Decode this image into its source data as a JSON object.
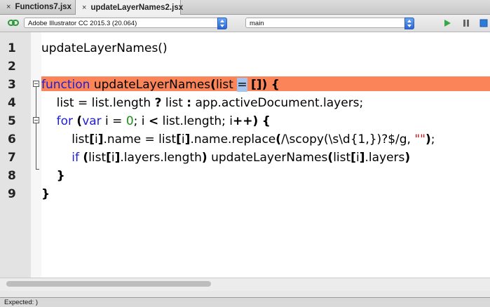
{
  "tabs": [
    {
      "label": "Functions7.jsx",
      "close": "×"
    },
    {
      "label": "updateLayerNames2.jsx",
      "close": "×"
    }
  ],
  "toolbar": {
    "link_icon": "link-icon",
    "target_app": "Adobe Illustrator CC 2015.3 (20.064)",
    "engine": "main",
    "run_icon": "play-icon",
    "pause_icon": "pause-icon",
    "stop_icon": "stop-icon"
  },
  "editor": {
    "line_numbers": [
      "1",
      "2",
      "3",
      "4",
      "5",
      "6",
      "7",
      "8",
      "9"
    ],
    "highlight_line": 3
  },
  "status": {
    "text": "Expected: )"
  },
  "colors": {
    "keyword": "#1e1ed2",
    "number": "#1a8f1a",
    "string": "#c01a1a",
    "error_highlight": "#fb8558",
    "selection": "#a3c4ef"
  }
}
